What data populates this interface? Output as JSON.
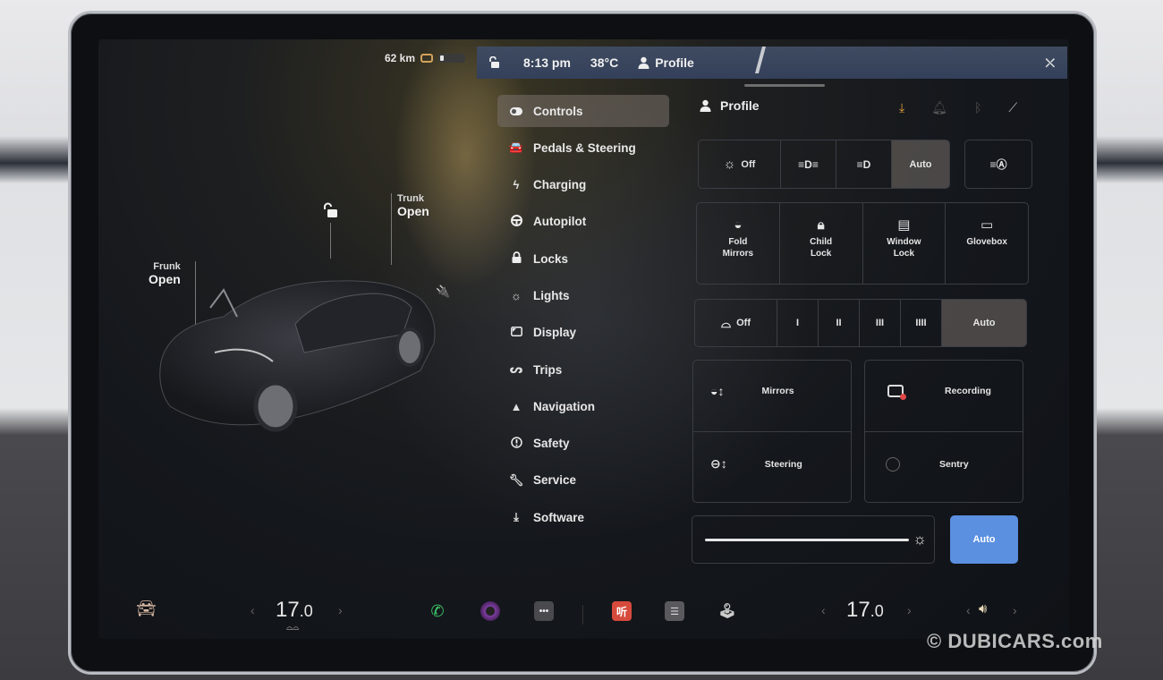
{
  "status": {
    "range": "62 km",
    "battery_level_fraction": 0.15,
    "time": "8:13 pm",
    "temperature": "38°C",
    "profile_label": "Profile"
  },
  "car_view": {
    "frunk_label": "Frunk",
    "frunk_state": "Open",
    "trunk_label": "Trunk",
    "trunk_state": "Open",
    "lock_state": "unlocked"
  },
  "menu": {
    "items": [
      {
        "label": "Controls",
        "icon": "toggle-icon",
        "active": true
      },
      {
        "label": "Pedals & Steering",
        "icon": "car-icon"
      },
      {
        "label": "Charging",
        "icon": "bolt-icon"
      },
      {
        "label": "Autopilot",
        "icon": "steering-wheel-icon"
      },
      {
        "label": "Locks",
        "icon": "lock-icon"
      },
      {
        "label": "Lights",
        "icon": "sun-icon"
      },
      {
        "label": "Display",
        "icon": "display-icon"
      },
      {
        "label": "Trips",
        "icon": "trips-icon"
      },
      {
        "label": "Navigation",
        "icon": "navigation-arrow-icon"
      },
      {
        "label": "Safety",
        "icon": "alert-circle-icon"
      },
      {
        "label": "Service",
        "icon": "wrench-icon"
      },
      {
        "label": "Software",
        "icon": "download-icon"
      }
    ]
  },
  "panel": {
    "profile_label": "Profile",
    "header_icons": [
      "download-icon",
      "bell-icon",
      "bluetooth-icon",
      "signal-off-icon"
    ],
    "accent_color": "#e8a23a",
    "lights": {
      "options": [
        "Off",
        "parking-lights-icon",
        "low-beam-icon",
        "Auto"
      ],
      "selected": "Auto",
      "auto_high_beam_icon": "auto-high-beam-icon"
    },
    "tiles": [
      {
        "label_1": "Fold",
        "label_2": "Mirrors",
        "icon": "mirror-icon"
      },
      {
        "label_1": "Child",
        "label_2": "Lock",
        "icon": "child-lock-icon"
      },
      {
        "label_1": "Window",
        "label_2": "Lock",
        "icon": "window-lock-icon"
      },
      {
        "label_1": "Glovebox",
        "label_2": "",
        "icon": "glovebox-icon"
      }
    ],
    "wipers": {
      "options": [
        "Off",
        "I",
        "II",
        "III",
        "IIII",
        "Auto"
      ],
      "selected": "Auto"
    },
    "adjust": {
      "mirrors": "Mirrors",
      "steering": "Steering",
      "recording": "Recording",
      "sentry": "Sentry"
    },
    "brightness": {
      "level_fraction": 1.0,
      "auto_label": "Auto"
    }
  },
  "bottom_bar": {
    "driver_temp": "17",
    "driver_temp_decimal": ".0",
    "passenger_temp": "17",
    "passenger_temp_decimal": ".0",
    "chev_left": "‹",
    "chev_right": "›",
    "apps": [
      "car-icon",
      "phone-icon",
      "camera-icon",
      "more-icon",
      "music-app-icon",
      "notes-icon",
      "joystick-icon"
    ],
    "music_app_label": "听"
  },
  "watermark": "© DUBICARS.com"
}
